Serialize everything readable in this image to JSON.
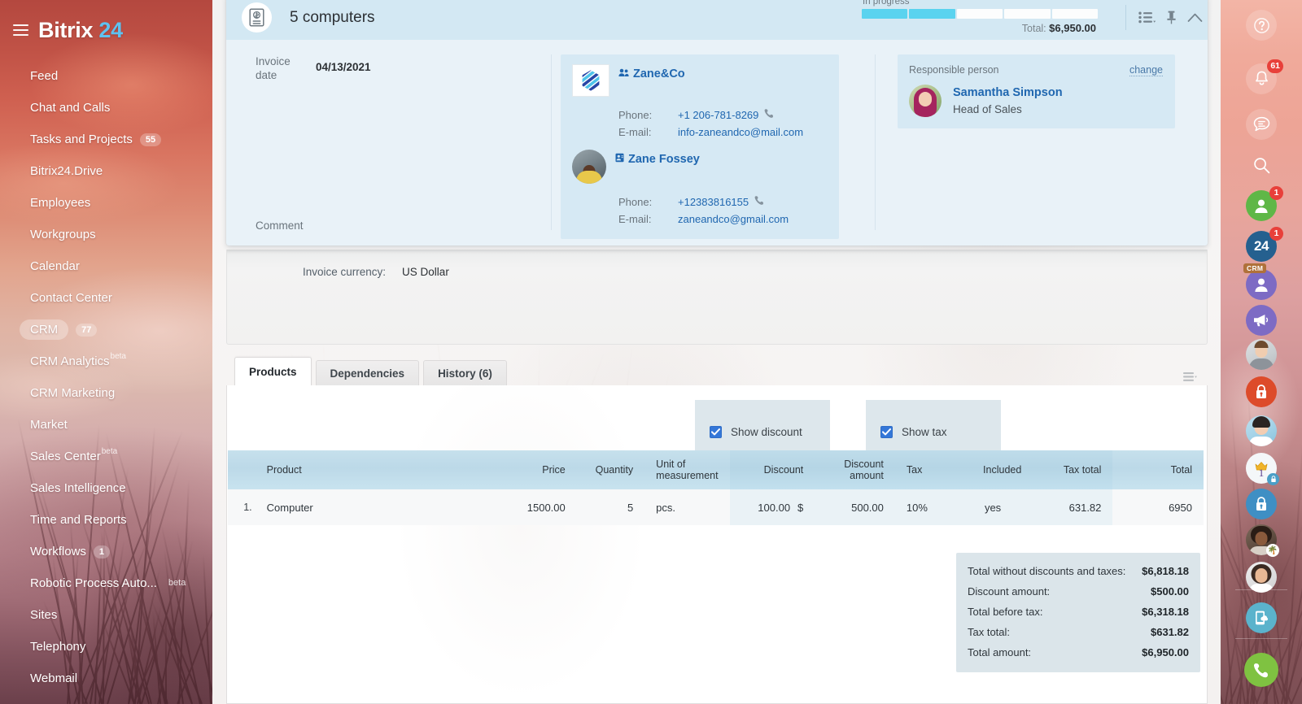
{
  "brand": {
    "name": "Bitrix",
    "number": "24",
    "menu_icon": "hamburger-icon"
  },
  "sidebar": {
    "items": [
      {
        "label": "Feed",
        "count": null,
        "beta": false,
        "active": false
      },
      {
        "label": "Chat and Calls",
        "count": null,
        "beta": false,
        "active": false
      },
      {
        "label": "Tasks and Projects",
        "count": "55",
        "beta": false,
        "active": false
      },
      {
        "label": "Bitrix24.Drive",
        "count": null,
        "beta": false,
        "active": false
      },
      {
        "label": "Employees",
        "count": null,
        "beta": false,
        "active": false
      },
      {
        "label": "Workgroups",
        "count": null,
        "beta": false,
        "active": false
      },
      {
        "label": "Calendar",
        "count": null,
        "beta": false,
        "active": false
      },
      {
        "label": "Contact Center",
        "count": null,
        "beta": false,
        "active": false
      },
      {
        "label": "CRM",
        "count": "77",
        "beta": false,
        "active": true
      },
      {
        "label": "CRM Analytics",
        "count": null,
        "beta": true,
        "active": false
      },
      {
        "label": "CRM Marketing",
        "count": null,
        "beta": false,
        "active": false
      },
      {
        "label": "Market",
        "count": null,
        "beta": false,
        "active": false
      },
      {
        "label": "Sales Center",
        "count": null,
        "beta": true,
        "active": false
      },
      {
        "label": "Sales Intelligence",
        "count": null,
        "beta": false,
        "active": false
      },
      {
        "label": "Time and Reports",
        "count": null,
        "beta": false,
        "active": false
      },
      {
        "label": "Workflows",
        "count": "1",
        "beta": false,
        "active": false
      },
      {
        "label": "Robotic Process Auto...",
        "count": null,
        "beta": true,
        "beta_spaced": true,
        "active": false
      },
      {
        "label": "Sites",
        "count": null,
        "beta": false,
        "active": false
      },
      {
        "label": "Telephony",
        "count": null,
        "beta": false,
        "active": false
      },
      {
        "label": "Webmail",
        "count": null,
        "beta": false,
        "active": false
      }
    ],
    "beta_label": "beta"
  },
  "invoice": {
    "title": "5 computers",
    "icon": "invoice-document-icon",
    "progress": {
      "status_label": "In progress",
      "segments": 5,
      "filled": 2,
      "total_label": "Total:",
      "total_value": "$6,950.00"
    },
    "tools": [
      {
        "name": "list-view-icon",
        "label": "List view"
      },
      {
        "name": "pin-icon",
        "label": "Pin"
      },
      {
        "name": "collapse-chevron-up-icon",
        "label": "Collapse"
      }
    ],
    "date_label": "Invoice date",
    "date_value": "04/13/2021",
    "comment_label": "Comment",
    "currency_label": "Invoice currency:",
    "currency_value": "US Dollar"
  },
  "client": {
    "company_name": "Zane&Co",
    "company_logo": "zane-co-hexagon-logo",
    "company_phone_label": "Phone:",
    "company_phone": "+1 206-781-8269",
    "company_email_label": "E-mail:",
    "company_email": "info-zaneandco@mail.com",
    "contact_name": "Zane Fossey",
    "contact_phone_label": "Phone:",
    "contact_phone": "+12383816155",
    "contact_email_label": "E-mail:",
    "contact_email": "zaneandco@gmail.com"
  },
  "responsible": {
    "title": "Responsible person",
    "change_link": "change",
    "name": "Samantha Simpson",
    "role": "Head of Sales"
  },
  "tabs": [
    {
      "label": "Products",
      "active": true
    },
    {
      "label": "Dependencies",
      "active": false
    },
    {
      "label": "History (6)",
      "active": false
    }
  ],
  "products": {
    "show_discount_label": "Show discount",
    "show_discount_checked": true,
    "show_tax_label": "Show tax",
    "show_tax_checked": true,
    "columns": [
      "Product",
      "Price",
      "Quantity",
      "Unit of measurement",
      "Discount",
      "Discount amount",
      "Tax",
      "Included",
      "Tax total",
      "Total"
    ],
    "rows": [
      {
        "index": "1.",
        "product": "Computer",
        "price": "1500.00",
        "quantity": "5",
        "unit": "pcs.",
        "discount": "100.00",
        "discount_currency": "$",
        "discount_amount": "500.00",
        "tax": "10%",
        "included": "yes",
        "tax_total": "631.82",
        "total": "6950"
      }
    ]
  },
  "totals": [
    {
      "label": "Total without discounts and taxes:",
      "value": "$6,818.18"
    },
    {
      "label": "Discount amount:",
      "value": "$500.00"
    },
    {
      "label": "Total before tax:",
      "value": "$6,318.18"
    },
    {
      "label": "Tax total:",
      "value": "$631.82"
    },
    {
      "label": "Total amount:",
      "value": "$6,950.00"
    }
  ],
  "rail": [
    {
      "name": "help-icon",
      "badge": null
    },
    {
      "name": "notifications-bell-icon",
      "badge": "61"
    },
    {
      "name": "messages-chat-icon",
      "badge": null
    },
    {
      "name": "search-icon",
      "badge": null
    },
    {
      "name": "contact-green-icon",
      "badge": "1"
    },
    {
      "name": "bitrix24-icon",
      "badge": "1",
      "text": "24"
    },
    {
      "name": "crm-contact-icon",
      "badge": null,
      "tag": "CRM"
    },
    {
      "name": "megaphone-icon",
      "badge": null
    },
    {
      "name": "user-avatar-1",
      "badge": null
    },
    {
      "name": "lock-red-icon",
      "badge": null
    },
    {
      "name": "user-avatar-2",
      "badge": null
    },
    {
      "name": "anniversary-one-icon",
      "badge": null
    },
    {
      "name": "lock-blue-icon",
      "badge": null
    },
    {
      "name": "user-avatar-3-vacation",
      "badge": null
    },
    {
      "name": "user-avatar-4",
      "badge": null
    },
    {
      "name": "mobile-cloud-icon",
      "badge": null
    },
    {
      "name": "phone-call-green-icon",
      "badge": null
    }
  ],
  "colors": {
    "brand_blue": "#5ec2f0",
    "link_blue": "#2067b0",
    "progress_fill": "#5ad3ef",
    "checkbox_blue": "#3477d8",
    "badge_red": "#e8403a",
    "card_bg": "#e9f2f8",
    "card_header_bg": "#d3e8f3"
  }
}
